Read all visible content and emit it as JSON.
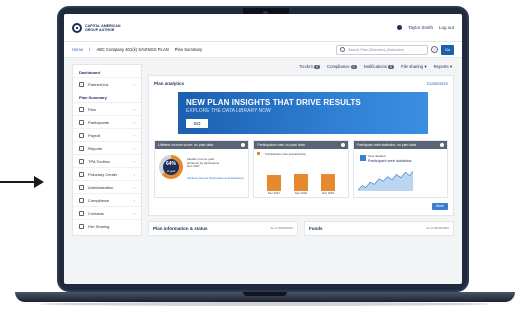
{
  "app": {
    "logo_text": "CAPITAL AMERICAN GROUP AUTHOR",
    "user_name": "Taylor Smith",
    "logout": "Log out"
  },
  "breadcrumb": {
    "home": "Home",
    "plan": "ABC Company 401(k) SAVINGS PLAN",
    "current": "Plan Summary"
  },
  "search": {
    "placeholder": "Search Plan (Selection) (Selection)",
    "help": "?",
    "go": "Go"
  },
  "sidebar": {
    "dashboard": "Dashboard",
    "partner_link": "PartnerLink",
    "plan_summary": "Plan Summary",
    "items": [
      {
        "label": "Plan",
        "icon": "document-icon"
      },
      {
        "label": "Participants",
        "icon": "people-icon"
      },
      {
        "label": "Payroll",
        "icon": "payroll-icon"
      },
      {
        "label": "Reports",
        "icon": "report-icon"
      },
      {
        "label": "TPA Toolbox",
        "icon": "toolbox-icon"
      },
      {
        "label": "Fiduciary Center",
        "icon": "shield-icon"
      },
      {
        "label": "Administration",
        "icon": "gear-icon"
      },
      {
        "label": "Compliance",
        "icon": "compliance-icon"
      },
      {
        "label": "Contacts",
        "icon": "contacts-icon"
      },
      {
        "label": "File Sharing",
        "icon": "file-icon"
      }
    ]
  },
  "toolbar": {
    "todo": "To-do's",
    "todo_count": "0",
    "compliance": "Compliance",
    "compliance_count": "0",
    "notifications": "Notifications",
    "notifications_count": "0",
    "file_sharing": "File sharing",
    "reports": "Reports"
  },
  "plan_analytics": {
    "title": "Plan analytics",
    "customize": "Customize",
    "banner_title": "NEW PLAN INSIGHTS THAT DRIVE RESULTS",
    "banner_subtitle": "EXPLORE THE DATA LIBRARY NOW",
    "banner_button": "GO",
    "more": "More"
  },
  "cards": {
    "card1": {
      "title": "Lifetime income score: no plan data",
      "value": "64%",
      "value_sub": "of goal",
      "note": "Median income goal achieved by participants Dec 2017",
      "link": "Lifetime income information and disclosure"
    },
    "card2": {
      "title": "Participation rate: no plan data",
      "legend": "Participation rate (participants)",
      "bars": [
        {
          "label": "Dec 2017",
          "value": 62
        },
        {
          "label": "Dec 2018",
          "value": 64
        },
        {
          "label": "Dec 2019",
          "value": 66
        }
      ]
    },
    "card3": {
      "title": "Participant web statistics: no plan data",
      "line1": "View detailed",
      "line2": "Participant web statistics"
    }
  },
  "bottom": {
    "plan_info": "Plan information & status",
    "plan_info_date": "As of 09/06/2020",
    "funds": "Funds",
    "funds_date": "As of 09/06/2020"
  },
  "colors": {
    "navy": "#1e2e5a",
    "accent": "#1d5fae",
    "orange": "#e68a2e",
    "frame": "#1f2a3d"
  }
}
